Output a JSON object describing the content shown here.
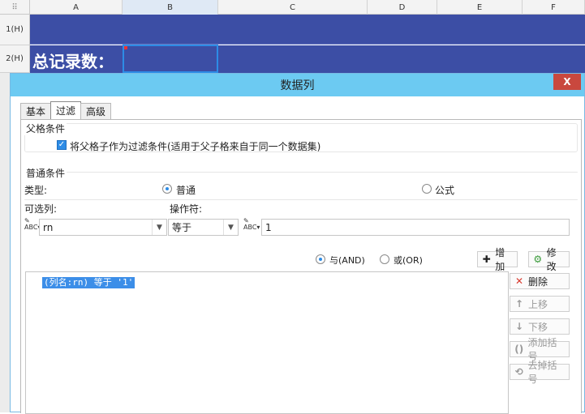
{
  "sheet": {
    "columns": [
      "A",
      "B",
      "C",
      "D",
      "E",
      "F"
    ],
    "rows": [
      "1(H)",
      "2(H)"
    ],
    "title_cell": "总记录数："
  },
  "dialog": {
    "title": "数据列",
    "close": "X",
    "tabs": [
      "基本",
      "过滤",
      "高级"
    ],
    "active_tab": "过滤",
    "parent_section": {
      "label": "父格条件",
      "checkbox_label": "将父格子作为过滤条件(适用于父子格来自于同一个数据集)",
      "checked": true
    },
    "common_section": {
      "label": "普通条件",
      "type_label": "类型:",
      "type_options": [
        "普通",
        "公式"
      ],
      "type_selected": "普通",
      "column_label": "可选列:",
      "operator_label": "操作符:",
      "column_value": "rn",
      "operator_value": "等于",
      "condition_value": "1"
    },
    "logic": {
      "options": [
        "与(AND)",
        "或(OR)"
      ],
      "selected": "与(AND)"
    },
    "buttons": {
      "add": "增加",
      "modify": "修改",
      "delete": "删除",
      "move_up": "上移",
      "move_down": "下移",
      "add_bracket": "添加括号",
      "remove_bracket": "去掉括号"
    },
    "conditions": [
      "(列名:rn) 等于 '1'"
    ]
  }
}
